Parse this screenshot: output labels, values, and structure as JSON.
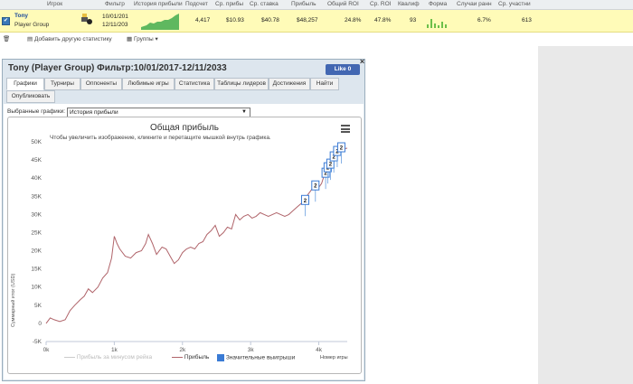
{
  "grid": {
    "columns": [
      "Игрок",
      "Фильтр",
      "История прибыли",
      "Подсчет",
      "Ср. прибы",
      "Ср. ставка",
      "Прибыль",
      "Общий ROI",
      "Ср. ROI",
      "Квалиф",
      "Форма",
      "Случаи ранн",
      "Ср. участни"
    ],
    "row": {
      "checkbox": "✔",
      "player_name": "Tony",
      "player_group": "Player Group",
      "filter_from": "10/01/201",
      "filter_to": "12/11/203",
      "count": "4,417",
      "avg_profit": "$10.93",
      "avg_stake": "$40.78",
      "profit": "$48,257",
      "total_roi": "24.8%",
      "avg_roi": "47.8%",
      "qualif": "93",
      "early": "6.7%",
      "avg_players": "613"
    }
  },
  "toolbar": {
    "add_stat": "Добавить другую статистику",
    "groups": "Группы"
  },
  "modal": {
    "title": "Tony (Player Group) Фильтр:10/01/2017-12/11/2033",
    "like": "Like 0",
    "close": "×",
    "tabs": [
      "Графики",
      "Турниры",
      "Оппоненты",
      "Любимые игры",
      "Статистика",
      "Таблицы лидеров",
      "Достижения",
      "Найти",
      "Опубликовать"
    ],
    "selected_label": "Выбранные графики:",
    "selected_value": "История прибыли"
  },
  "colors": {
    "profit_line": "#b0646a",
    "big_win": "#3a7bd5",
    "row_highlight": "#fffbb8"
  },
  "chart_data": {
    "type": "line",
    "title": "Общая прибыль",
    "subtitle": "Чтобы увеличить изображение, кликните и перетащите мышкой внутрь графика.",
    "ylabel": "Суммарный итог (USD)",
    "xlabel": "Номер игры",
    "ylim": [
      -5000,
      50000
    ],
    "xlim": [
      0,
      4417
    ],
    "yticks": [
      "-5K",
      "0",
      "5K",
      "10K",
      "15K",
      "20K",
      "25K",
      "30K",
      "35K",
      "40K",
      "45K",
      "50K"
    ],
    "ytick_values": [
      -5000,
      0,
      5000,
      10000,
      15000,
      20000,
      25000,
      30000,
      35000,
      40000,
      45000,
      50000
    ],
    "xticks": [
      "0k",
      "1k",
      "2k",
      "3k",
      "4k"
    ],
    "xtick_values": [
      0,
      1000,
      2000,
      3000,
      4000
    ],
    "grid": false,
    "legend": [
      "Прибыль за минусом рейка",
      "Прибыль",
      "Значительные выигрыши"
    ],
    "series": [
      {
        "name": "Прибыль",
        "x": [
          0,
          60,
          120,
          200,
          280,
          350,
          420,
          500,
          560,
          620,
          680,
          760,
          830,
          900,
          960,
          1000,
          1040,
          1080,
          1160,
          1240,
          1320,
          1400,
          1460,
          1500,
          1560,
          1620,
          1700,
          1760,
          1820,
          1880,
          1940,
          2000,
          2060,
          2120,
          2180,
          2240,
          2300,
          2360,
          2420,
          2480,
          2540,
          2600,
          2660,
          2720,
          2780,
          2840,
          2900,
          2960,
          3020,
          3080,
          3140,
          3200,
          3260,
          3320,
          3380,
          3440,
          3500,
          3560,
          3620,
          3680,
          3740,
          3800,
          3860,
          3920,
          3980,
          4040,
          4100,
          4160,
          4220,
          4280,
          4340,
          4417
        ],
        "y": [
          0,
          1500,
          1000,
          500,
          1000,
          3500,
          5000,
          6500,
          7500,
          9500,
          8500,
          10000,
          12500,
          14000,
          18000,
          24000,
          22000,
          20500,
          18500,
          18000,
          19500,
          20000,
          22000,
          24500,
          22000,
          19000,
          21000,
          20500,
          18500,
          16500,
          17500,
          19500,
          20500,
          21000,
          20500,
          22000,
          22500,
          24500,
          25500,
          27000,
          24000,
          25000,
          26500,
          26000,
          30000,
          28500,
          29500,
          30000,
          29000,
          29500,
          30500,
          30000,
          29500,
          30000,
          30500,
          30000,
          29500,
          30000,
          31000,
          32000,
          33000,
          34500,
          36000,
          37500,
          37000,
          38500,
          42000,
          44000,
          46000,
          47500,
          48000,
          48257
        ]
      }
    ],
    "big_wins": [
      {
        "x": 3800,
        "y": 34000
      },
      {
        "x": 3950,
        "y": 38000
      },
      {
        "x": 4100,
        "y": 41500
      },
      {
        "x": 4130,
        "y": 43000
      },
      {
        "x": 4170,
        "y": 44000
      },
      {
        "x": 4220,
        "y": 46000
      },
      {
        "x": 4270,
        "y": 47500
      },
      {
        "x": 4330,
        "y": 48500
      }
    ]
  }
}
